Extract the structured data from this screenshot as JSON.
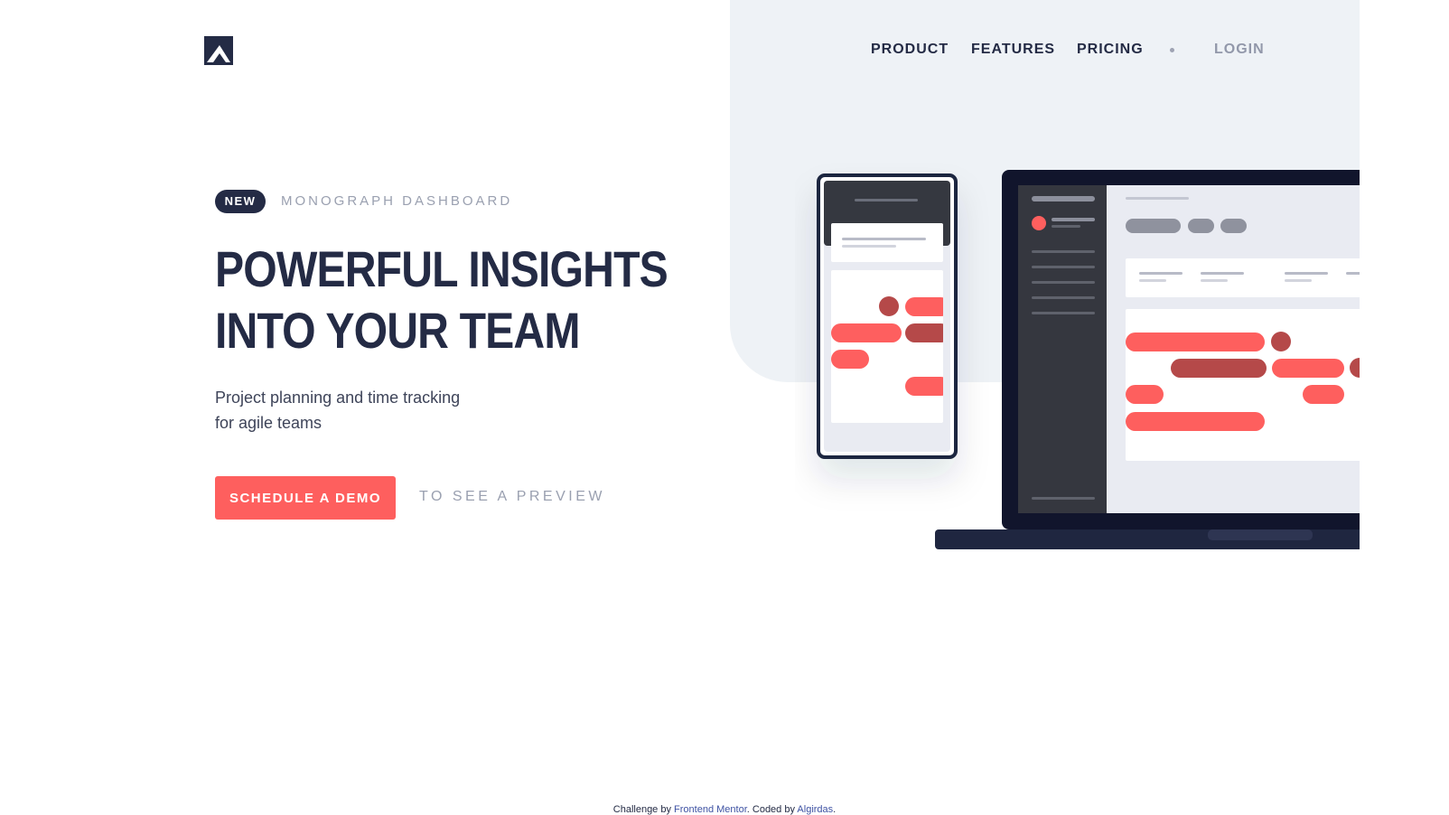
{
  "nav": {
    "product": "PRODUCT",
    "features": "FEATURES",
    "pricing": "PRICING",
    "login": "LOGIN"
  },
  "hero": {
    "badge": "NEW",
    "tag": "MONOGRAPH DASHBOARD",
    "headline_line1": "POWERFUL INSIGHTS",
    "headline_line2": "INTO YOUR TEAM",
    "sub_line1": "Project planning and time tracking",
    "sub_line2": "for agile teams",
    "cta": "SCHEDULE A DEMO",
    "preview": "TO SEE A PREVIEW"
  },
  "footer": {
    "prefix": "Challenge by ",
    "challenge_link": "Frontend Mentor",
    "middle": ". Coded by ",
    "author_link": "Algirdas",
    "suffix": "."
  },
  "icons": {
    "logo": "monograph-logo-icon",
    "nav_separator": "dot-icon"
  },
  "colors": {
    "dark": "#242b45",
    "accent": "#fe5f5e",
    "accent_dark": "#b54949",
    "muted": "#9aa0b0",
    "panel_bg": "#eef2f6"
  }
}
